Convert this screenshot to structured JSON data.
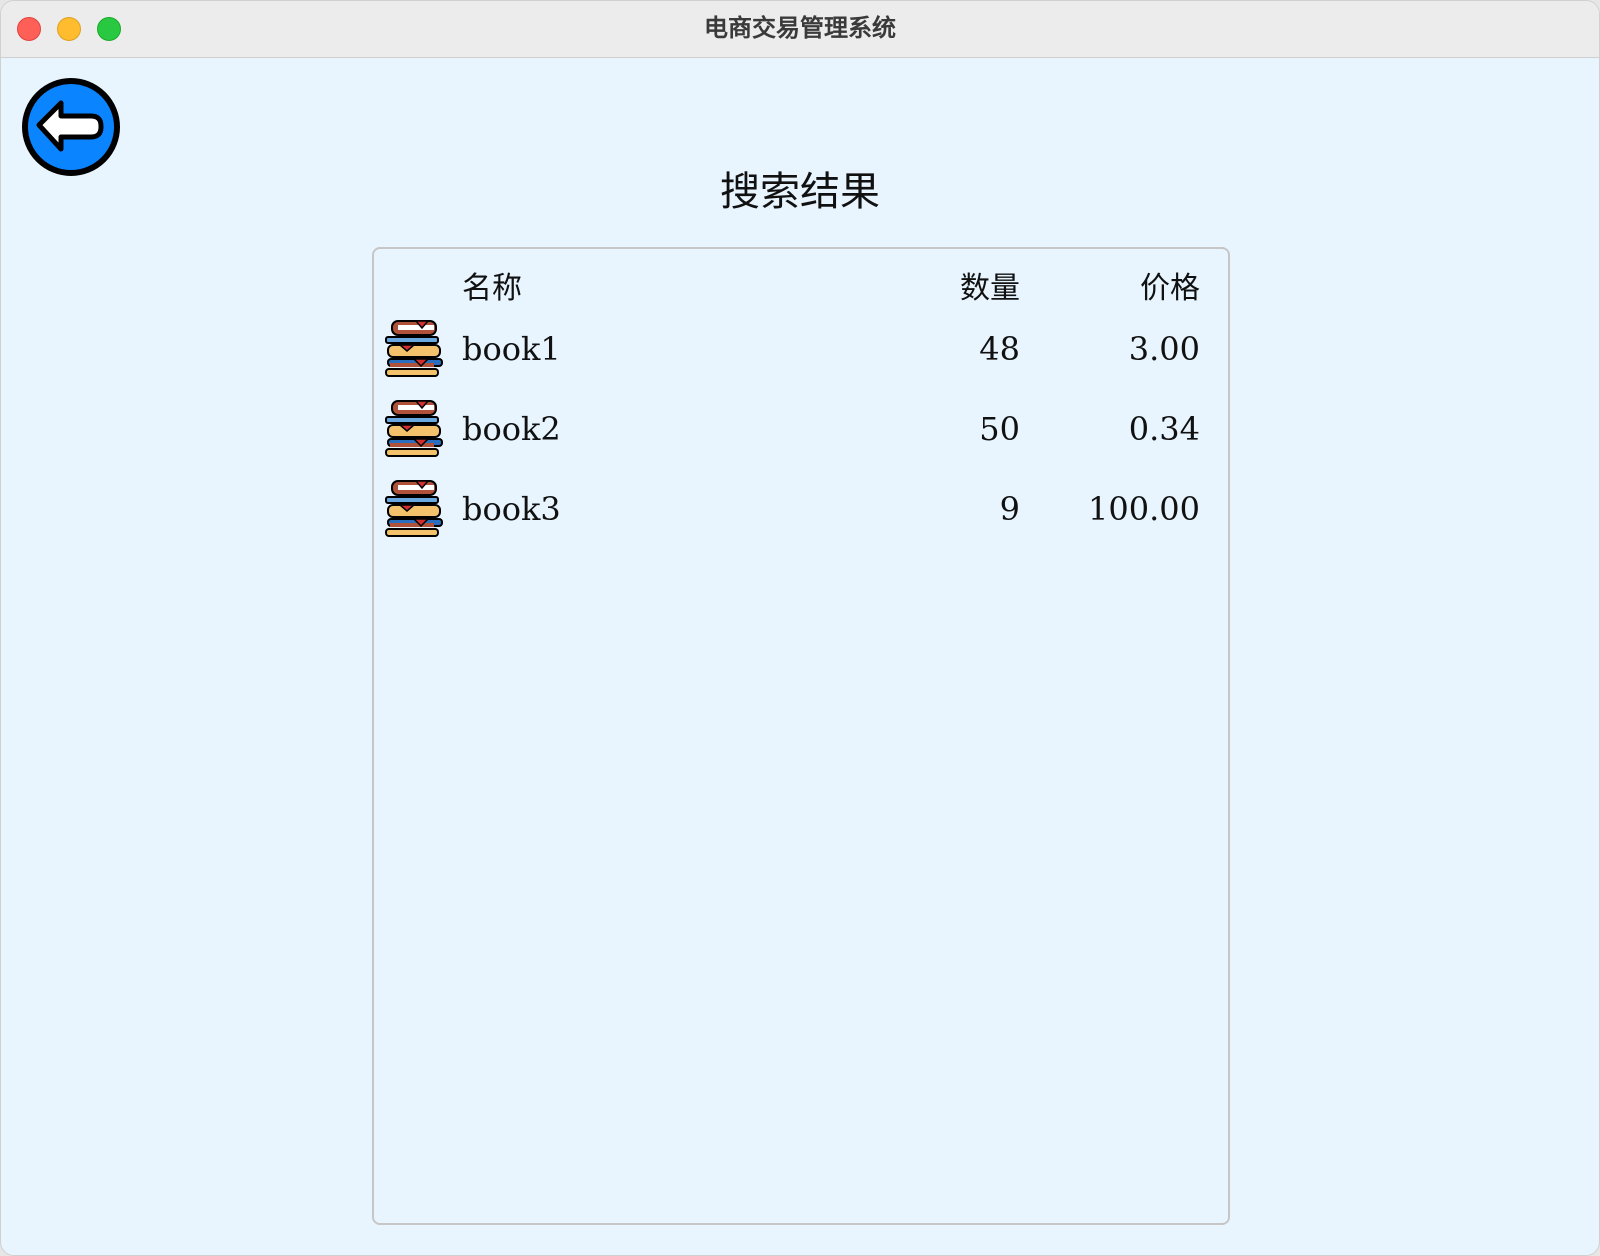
{
  "window": {
    "title": "电商交易管理系统"
  },
  "back_button": {
    "icon": "arrow-left-circle-icon",
    "color": "#0a84ff"
  },
  "page": {
    "title": "搜索结果"
  },
  "table": {
    "headers": {
      "name": "名称",
      "quantity": "数量",
      "price": "价格"
    },
    "rows": [
      {
        "icon": "book-stack-icon",
        "name": "book1",
        "quantity": "48",
        "price": "3.00"
      },
      {
        "icon": "book-stack-icon",
        "name": "book2",
        "quantity": "50",
        "price": "0.34"
      },
      {
        "icon": "book-stack-icon",
        "name": "book3",
        "quantity": "9",
        "price": "100.00"
      }
    ]
  }
}
